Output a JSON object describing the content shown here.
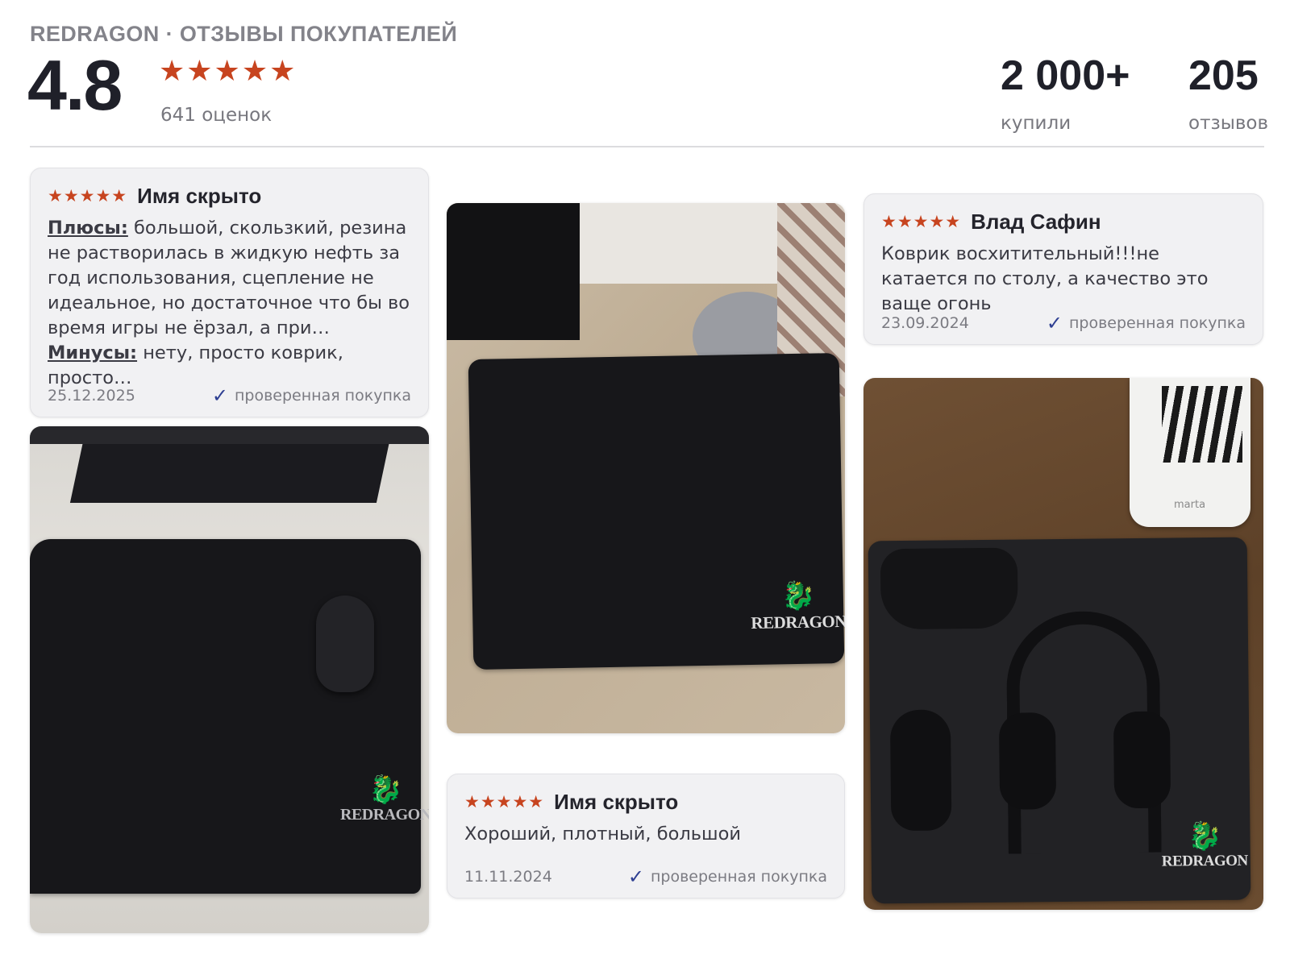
{
  "header": {
    "brand_line": "REDRAGON · ОТЗЫВЫ ПОКУПАТЕЛЕЙ",
    "rating": "4.8",
    "stars": "★★★★★",
    "ratings_count": "641 оценок",
    "stats": [
      {
        "value": "2 000+",
        "label": "купили"
      },
      {
        "value": "205",
        "label": "отзывов"
      }
    ]
  },
  "reviews": [
    {
      "stars": "★★★★★",
      "author": "Имя скрыто",
      "pros_label": "Плюсы:",
      "pros_text": " большой, скользкий, резина не растворилась в жидкую нефть за год использования, сцепление не идеальное, но достаточное что бы во время игры не ёрзал, а при…",
      "cons_label": "Минусы:",
      "cons_text": " нету, просто коврик, просто…",
      "date": "25.12.2025",
      "verified": "проверенная покупка"
    },
    {
      "stars": "★★★★★",
      "author": "Влад Сафин",
      "text": "Коврик восхитительный!!!не катается по столу, а качество это ваще огонь",
      "date": "23.09.2024",
      "verified": "проверенная покупка"
    },
    {
      "stars": "★★★★★",
      "author": "Имя скрыто",
      "text": "Хороший, плотный, большой",
      "date": "11.11.2024",
      "verified": "проверенная покупка"
    }
  ],
  "photos": {
    "logo_text": "REDRAGON",
    "fan_brand": "marta"
  },
  "icons": {
    "verified": "checkmark-icon",
    "rating": "star-icon"
  },
  "colors": {
    "star": "#c7441f",
    "check": "#2e3f92",
    "card_bg": "#f1f1f3"
  }
}
